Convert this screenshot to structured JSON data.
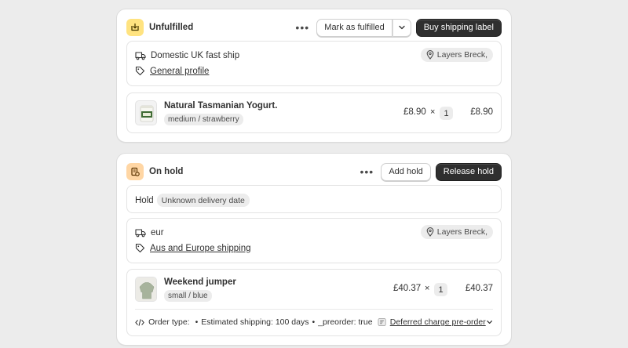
{
  "unfulfilled": {
    "title": "Unfulfilled",
    "more_label": "•••",
    "mark_fulfilled_label": "Mark as fulfilled",
    "buy_label_button": "Buy shipping label",
    "shipping_method": "Domestic UK fast ship",
    "profile_link": "General profile",
    "location": "Layers Breck,",
    "item": {
      "name": "Natural Tasmanian Yogurt.",
      "variant": "medium / strawberry",
      "unit_price": "£8.90",
      "times": "×",
      "qty": "1",
      "total": "£8.90"
    }
  },
  "on_hold": {
    "title": "On hold",
    "more_label": "•••",
    "add_hold_label": "Add hold",
    "release_hold_label": "Release hold",
    "hold_label": "Hold",
    "hold_badge": "Unknown delivery date",
    "shipping_method": "eur",
    "profile_link": "Aus and Europe shipping",
    "location": "Layers Breck,",
    "item": {
      "name": "Weekend jumper",
      "variant": "small / blue",
      "unit_price": "£40.37",
      "times": "×",
      "qty": "1",
      "total": "£40.37"
    },
    "attributes": {
      "label": "Order type:",
      "bullet": "•",
      "est_shipping": "Estimated shipping: 100 days",
      "preorder": "_preorder: true",
      "deferred_link": "Deferred charge pre-order"
    }
  },
  "colors": {
    "unfulfilled_icon_bg": "#ffe380",
    "on_hold_icon_bg": "#ffd6a4",
    "primary_button": "#2f2f2f"
  }
}
